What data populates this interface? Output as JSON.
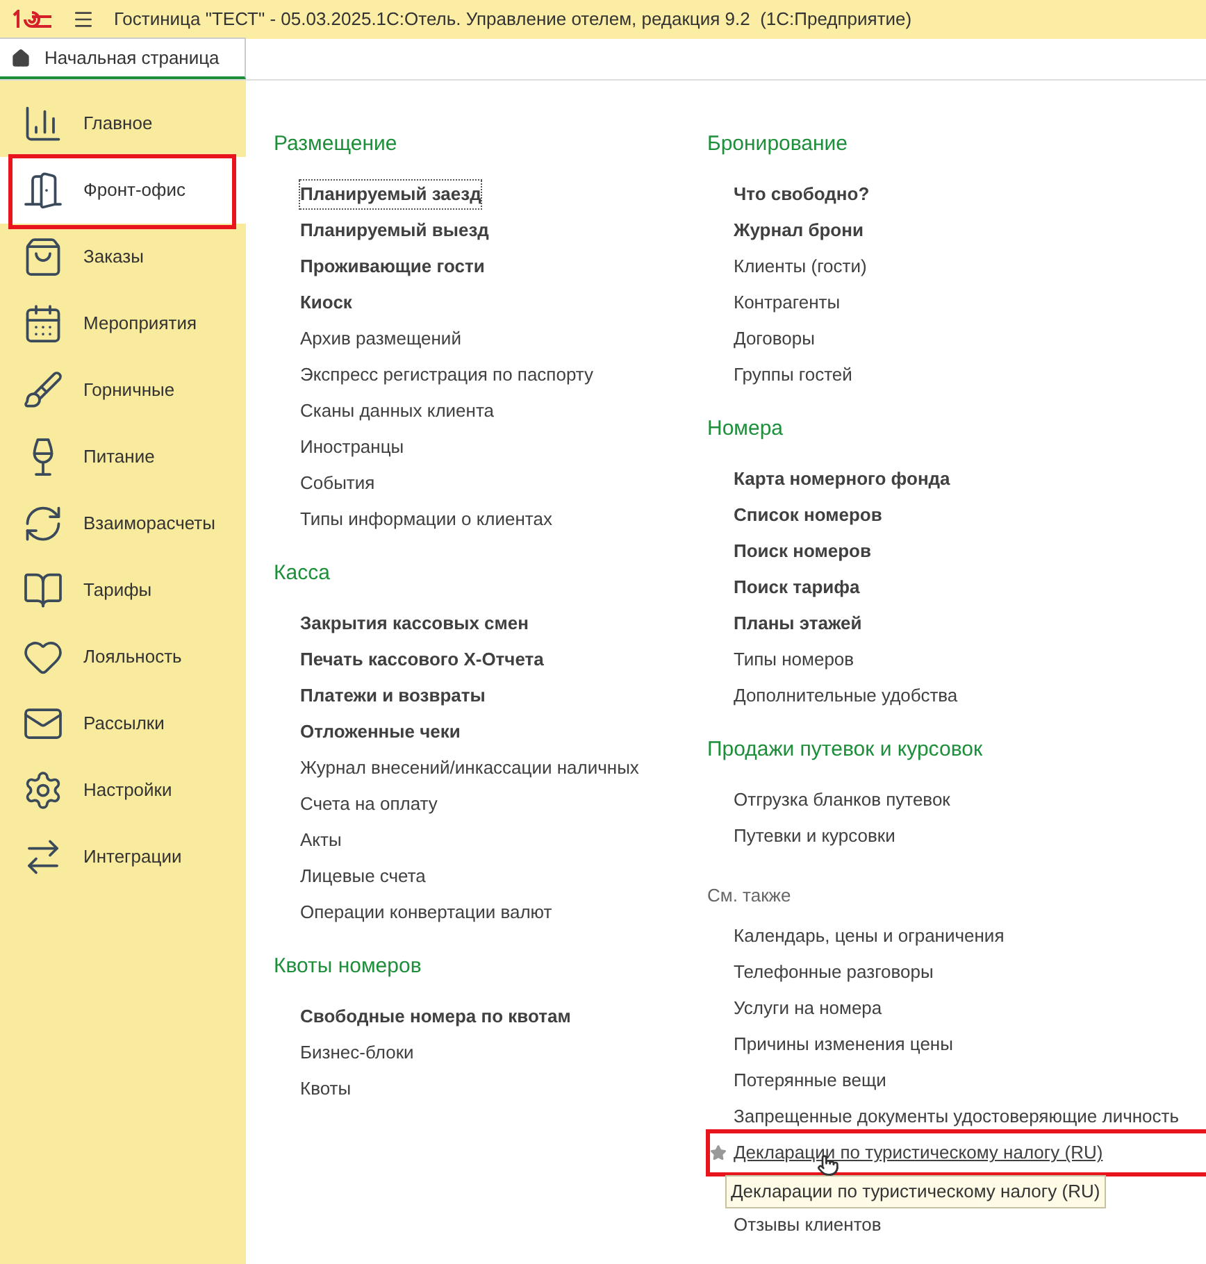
{
  "window": {
    "title": "Гостиница \"ТЕСТ\" - 05.03.2025.1С:Отель. Управление отелем, редакция 9.2  (1С:Предприятие)"
  },
  "tabs": [
    {
      "label": "Начальная страница",
      "selected": true
    }
  ],
  "sidebar": {
    "items": [
      {
        "label": "Главное",
        "selected": false,
        "highlighted": false
      },
      {
        "label": "Фронт-офис",
        "selected": true,
        "highlighted": true
      },
      {
        "label": "Заказы",
        "selected": false,
        "highlighted": false
      },
      {
        "label": "Мероприятия",
        "selected": false,
        "highlighted": false
      },
      {
        "label": "Горничные",
        "selected": false,
        "highlighted": false
      },
      {
        "label": "Питание",
        "selected": false,
        "highlighted": false
      },
      {
        "label": "Взаиморасчеты",
        "selected": false,
        "highlighted": false
      },
      {
        "label": "Тарифы",
        "selected": false,
        "highlighted": false
      },
      {
        "label": "Лояльность",
        "selected": false,
        "highlighted": false
      },
      {
        "label": "Рассылки",
        "selected": false,
        "highlighted": false
      },
      {
        "label": "Настройки",
        "selected": false,
        "highlighted": false
      },
      {
        "label": "Интеграции",
        "selected": false,
        "highlighted": false
      }
    ]
  },
  "columns": [
    [
      {
        "kind": "section",
        "title": "Размещение",
        "items": [
          {
            "label": "Планируемый заезд",
            "bold": true,
            "focused": true
          },
          {
            "label": "Планируемый выезд",
            "bold": true
          },
          {
            "label": "Проживающие гости",
            "bold": true
          },
          {
            "label": "Киоск",
            "bold": true
          },
          {
            "label": "Архив размещений",
            "bold": false
          },
          {
            "label": "Экспресс регистрация по паспорту",
            "bold": false
          },
          {
            "label": "Сканы данных клиента",
            "bold": false
          },
          {
            "label": "Иностранцы",
            "bold": false
          },
          {
            "label": "События",
            "bold": false
          },
          {
            "label": "Типы информации о клиентах",
            "bold": false
          }
        ]
      },
      {
        "kind": "section",
        "title": "Касса",
        "items": [
          {
            "label": "Закрытия кассовых смен",
            "bold": true
          },
          {
            "label": "Печать кассового X-Отчета",
            "bold": true
          },
          {
            "label": "Платежи и возвраты",
            "bold": true
          },
          {
            "label": "Отложенные чеки",
            "bold": true
          },
          {
            "label": "Журнал внесений/инкассации наличных",
            "bold": false
          },
          {
            "label": "Счета на оплату",
            "bold": false
          },
          {
            "label": "Акты",
            "bold": false
          },
          {
            "label": "Лицевые счета",
            "bold": false
          },
          {
            "label": "Операции конвертации валют",
            "bold": false
          }
        ]
      },
      {
        "kind": "section",
        "title": "Квоты номеров",
        "items": [
          {
            "label": "Свободные номера по квотам",
            "bold": true
          },
          {
            "label": "Бизнес-блоки",
            "bold": false
          },
          {
            "label": "Квоты",
            "bold": false
          }
        ]
      }
    ],
    [
      {
        "kind": "section",
        "title": "Бронирование",
        "items": [
          {
            "label": "Что свободно?",
            "bold": true
          },
          {
            "label": "Журнал брони",
            "bold": true
          },
          {
            "label": "Клиенты (гости)",
            "bold": false
          },
          {
            "label": "Контрагенты",
            "bold": false
          },
          {
            "label": "Договоры",
            "bold": false
          },
          {
            "label": "Группы гостей",
            "bold": false
          }
        ]
      },
      {
        "kind": "section",
        "title": "Номера",
        "items": [
          {
            "label": "Карта номерного фонда",
            "bold": true
          },
          {
            "label": "Список номеров",
            "bold": true
          },
          {
            "label": "Поиск номеров",
            "bold": true
          },
          {
            "label": "Поиск тарифа",
            "bold": true
          },
          {
            "label": "Планы этажей",
            "bold": true
          },
          {
            "label": "Типы номеров",
            "bold": false
          },
          {
            "label": "Дополнительные удобства",
            "bold": false
          }
        ]
      },
      {
        "kind": "section",
        "title": "Продажи путевок и курсовок",
        "items": [
          {
            "label": "Отгрузка бланков путевок",
            "bold": false
          },
          {
            "label": "Путевки и курсовки",
            "bold": false
          }
        ]
      },
      {
        "kind": "see_also",
        "title": "См. также",
        "items": [
          {
            "label": "Календарь, цены и ограничения",
            "bold": false
          },
          {
            "label": "Телефонные разговоры",
            "bold": false
          },
          {
            "label": "Услуги на номера",
            "bold": false
          },
          {
            "label": "Причины изменения цены",
            "bold": false
          },
          {
            "label": "Потерянные вещи",
            "bold": false
          },
          {
            "label": "Запрещенные документы удостоверяющие личность",
            "bold": false
          },
          {
            "label": "Декларации по туристическому налогу (RU)",
            "bold": false,
            "hovered": true,
            "highlighted": true,
            "tooltip": "Декларации по туристическому налогу (RU)"
          },
          {
            "label": "Отзывы клиентов",
            "bold": false
          }
        ]
      }
    ]
  ]
}
